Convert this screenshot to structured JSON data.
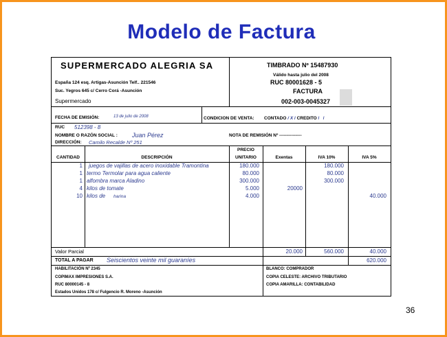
{
  "slide": {
    "title": "Modelo de Factura",
    "page_number": "36"
  },
  "invoice": {
    "company": "SUPERMERCADO ALEGRIA SA",
    "address_line1": "España 124 esq. Artigas-Asunción  Telf.. 221546",
    "address_line2": "Suc. Yegros 645 c/ Cerro Corá -Asunción",
    "branch": "Supermercado",
    "timbrado": "TIMBRADO Nº  15487930",
    "valido": "Válido  hasta julio del 2008",
    "ruc_header": "RUC  80001628 - 5",
    "doc_type": "FACTURA",
    "doc_number": "002-003-0045327",
    "fecha_label": "FECHA DE EMISIÓN:",
    "fecha_value": "13 de julio de 2008",
    "condicion_label": "CONDICION DE VENTA:",
    "condicion_contado": "CONTADO",
    "condicion_contado_mark": "X",
    "condicion_credito": "CREDITO",
    "ruc_label": "RUC",
    "ruc_value": "512398 - 8",
    "nombre_label": "NOMBRE O RAZÓN SOCIAL :",
    "nombre_value": "Juan Pérez",
    "remision_label": "NOTA DE REMISIÓN Nº ---------------",
    "direccion_label": "DIRECCIÓN:",
    "direccion_value": "Camilo Recalde Nº 251",
    "columns": {
      "cantidad": "CANTIDAD",
      "descripcion": "DESCRIPCIÓN",
      "precio_1": "PRECIO",
      "precio_2": "UNITARIO",
      "exentas": "Exentas",
      "iva10": "IVA 10%",
      "iva5": "IVA 5%"
    },
    "rows": [
      {
        "qty": "1",
        "desc": "juegos de vajillas de acero inoxidable Tramontina",
        "price": "180.000",
        "exentas": "",
        "iva10": "180.000",
        "iva5": ""
      },
      {
        "qty": "1",
        "desc": "termo Termolar para agua caliente",
        "price": "80.000",
        "exentas": "",
        "iva10": "80.000",
        "iva5": ""
      },
      {
        "qty": "1",
        "desc": "alfombra marca Aladino",
        "price": "300.000",
        "exentas": "",
        "iva10": "300.000",
        "iva5": ""
      },
      {
        "qty": "4",
        "desc": "kilos de tomate",
        "price": "5.000",
        "exentas": "20000",
        "iva10": "",
        "iva5": ""
      },
      {
        "qty": "10",
        "desc": "kilos de",
        "desc_extra": "harina",
        "price": "4.000",
        "exentas": "",
        "iva10": "",
        "iva5": "40.000"
      }
    ],
    "valor_parcial_label": "Valor Parcial",
    "valor_parcial": {
      "exentas": "20.000",
      "iva10": "560.000",
      "iva5": "40.000"
    },
    "total_label": "TOTAL  A PAGAR",
    "total_words": "Seiscientos veinte mil guaraníes",
    "total_value": "620.000",
    "habilitacion": "HABILITACIÓN Nº 2345",
    "imprenta": "COPIMAX IMPRESIONES S.A.",
    "imprenta_ruc": "RUC 80000145 - 8",
    "imprenta_dir": "Estados Unidos 178  c/ Fulgencio  R. Moreno -Asunción",
    "copia_blanco": "BLANCO: COMPRADOR",
    "copia_celeste": "COPIA CELESTE:  ARCHIVO TRIBUTARIO",
    "copia_amarilla": "COPIA  AMARILLA: CONTABILIDAD"
  }
}
